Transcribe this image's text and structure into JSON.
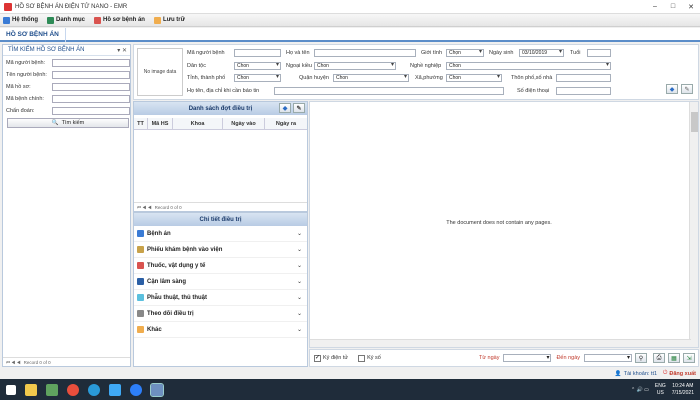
{
  "window": {
    "title": "HỒ SƠ BỆNH ÁN ĐIỆN TỬ NANO - EMR"
  },
  "menu": [
    {
      "label": "Hệ thống",
      "icon": "system-icon",
      "color": "#3a7bd5"
    },
    {
      "label": "Danh mục",
      "icon": "catalog-icon",
      "color": "#2e8b57"
    },
    {
      "label": "Hồ sơ bệnh án",
      "icon": "record-icon",
      "color": "#d9534f"
    },
    {
      "label": "Lưu trữ",
      "icon": "archive-icon",
      "color": "#f0ad4e"
    }
  ],
  "tabs": {
    "active": "HỒ SƠ BỆNH ÁN"
  },
  "search_panel": {
    "title": "TÌM KIẾM HỒ SƠ BỆNH ÁN",
    "fields": [
      {
        "label": "Mã người bệnh:",
        "value": ""
      },
      {
        "label": "Tên người bệnh:",
        "value": ""
      },
      {
        "label": "Mã hồ sơ:",
        "value": ""
      },
      {
        "label": "Mã bệnh chính:",
        "value": ""
      },
      {
        "label": "Chẩn đoán:",
        "value": ""
      }
    ],
    "search_button": "Tìm kiếm",
    "pager": "Record 0 of 0"
  },
  "patient_form": {
    "no_image": "No image data",
    "ma_nguoi_benh": "Mã người bệnh",
    "ho_va_ten": "Họ và tên",
    "gioi_tinh": "Giới tính",
    "gioi_tinh_value": "Chọn",
    "ngay_sinh": "Ngày sinh",
    "ngay_sinh_value": "03/10/2019",
    "tuoi": "Tuổi",
    "dan_toc": "Dân tộc",
    "dan_toc_value": "Chon",
    "ngoai_kieu": "Ngoại kiều",
    "ngoai_kieu_value": "Chon",
    "nghe_nghiep": "Nghề nghiệp",
    "nghe_nghiep_value": "Chon",
    "tinh_tp": "Tỉnh, thành phố",
    "tinh_tp_value": "Chon",
    "quan_huyen": "Quận huyện",
    "quan_huyen_value": "Chon",
    "xa_phuong": "Xã,phường",
    "xa_phuong_value": "Chon",
    "thon_pho": "Thôn phố,số nhà",
    "ho_ten_dia_chi": "Họ tên, địa chỉ khi cần báo tin",
    "so_dien_thoai": "Số điện thoại"
  },
  "treatment_list": {
    "title": "Danh sách đợt điều trị",
    "columns": [
      "TT",
      "Mã HS",
      "Khoa",
      "Ngày vào",
      "Ngày ra"
    ],
    "pager": "Record 0 of 0"
  },
  "details": {
    "title": "Chi tiết điều trị",
    "sections": [
      {
        "label": "Bệnh án",
        "icon": "book-icon",
        "color": "#3a7bd5"
      },
      {
        "label": "Phiếu khám bệnh vào viện",
        "icon": "form-icon",
        "color": "#c8a24a"
      },
      {
        "label": "Thuốc, vật dụng y tế",
        "icon": "medicine-icon",
        "color": "#d9534f"
      },
      {
        "label": "Cận lâm sàng",
        "icon": "monitor-icon",
        "color": "#2b5fa5"
      },
      {
        "label": "Phẫu thuật, thủ thuật",
        "icon": "surgery-icon",
        "color": "#5bc0de"
      },
      {
        "label": "Theo dõi điều trị",
        "icon": "pen-icon",
        "color": "#888888"
      },
      {
        "label": "Khác",
        "icon": "other-icon",
        "color": "#f0ad4e"
      }
    ]
  },
  "viewer": {
    "message": "The document does not contain any pages."
  },
  "bottom_bar": {
    "ky_dien_tu": "Ký điện tử",
    "ky_so": "Ký số",
    "tu_ngay": "Từ ngày",
    "den_ngay": "Đến ngày"
  },
  "status": {
    "account": "Tài khoản: tt1",
    "logout": "Đăng xuất"
  },
  "taskbar": {
    "lang": "ENG",
    "region": "US",
    "time": "10:24 AM",
    "date": "7/15/2021"
  },
  "colors": {
    "accent": "#1f4e8c",
    "panel_header": "#b8cbe4",
    "red_label": "#c0392b"
  }
}
